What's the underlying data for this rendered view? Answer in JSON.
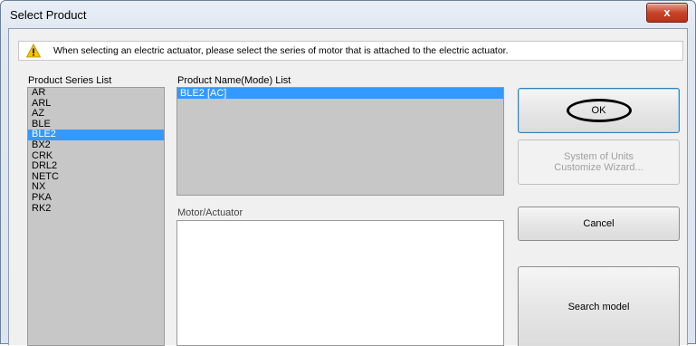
{
  "window": {
    "title": "Select Product",
    "close_label": "x"
  },
  "notice": {
    "text": "When selecting an electric actuator, please select the series of motor that is attached to the electric actuator."
  },
  "series": {
    "label": "Product Series List",
    "items": [
      "AR",
      "ARL",
      "AZ",
      "BLE",
      "BLE2",
      "BX2",
      "CRK",
      "DRL2",
      "NETC",
      "NX",
      "PKA",
      "RK2"
    ],
    "selected": "BLE2"
  },
  "product_names": {
    "label": "Product Name(Mode) List",
    "items": [
      "BLE2 [AC]"
    ],
    "selected": "BLE2 [AC]"
  },
  "motor": {
    "label": "Motor/Actuator"
  },
  "buttons": {
    "ok": "OK",
    "units_line1": "System of Units",
    "units_line2": "Customize Wizard...",
    "cancel": "Cancel",
    "search": "Search model"
  },
  "colors": {
    "selection": "#3399ff",
    "list_bg": "#c7c7c7",
    "close_button": "#c7452b"
  },
  "icons": {
    "notice": "warning-icon",
    "close": "close-icon"
  }
}
